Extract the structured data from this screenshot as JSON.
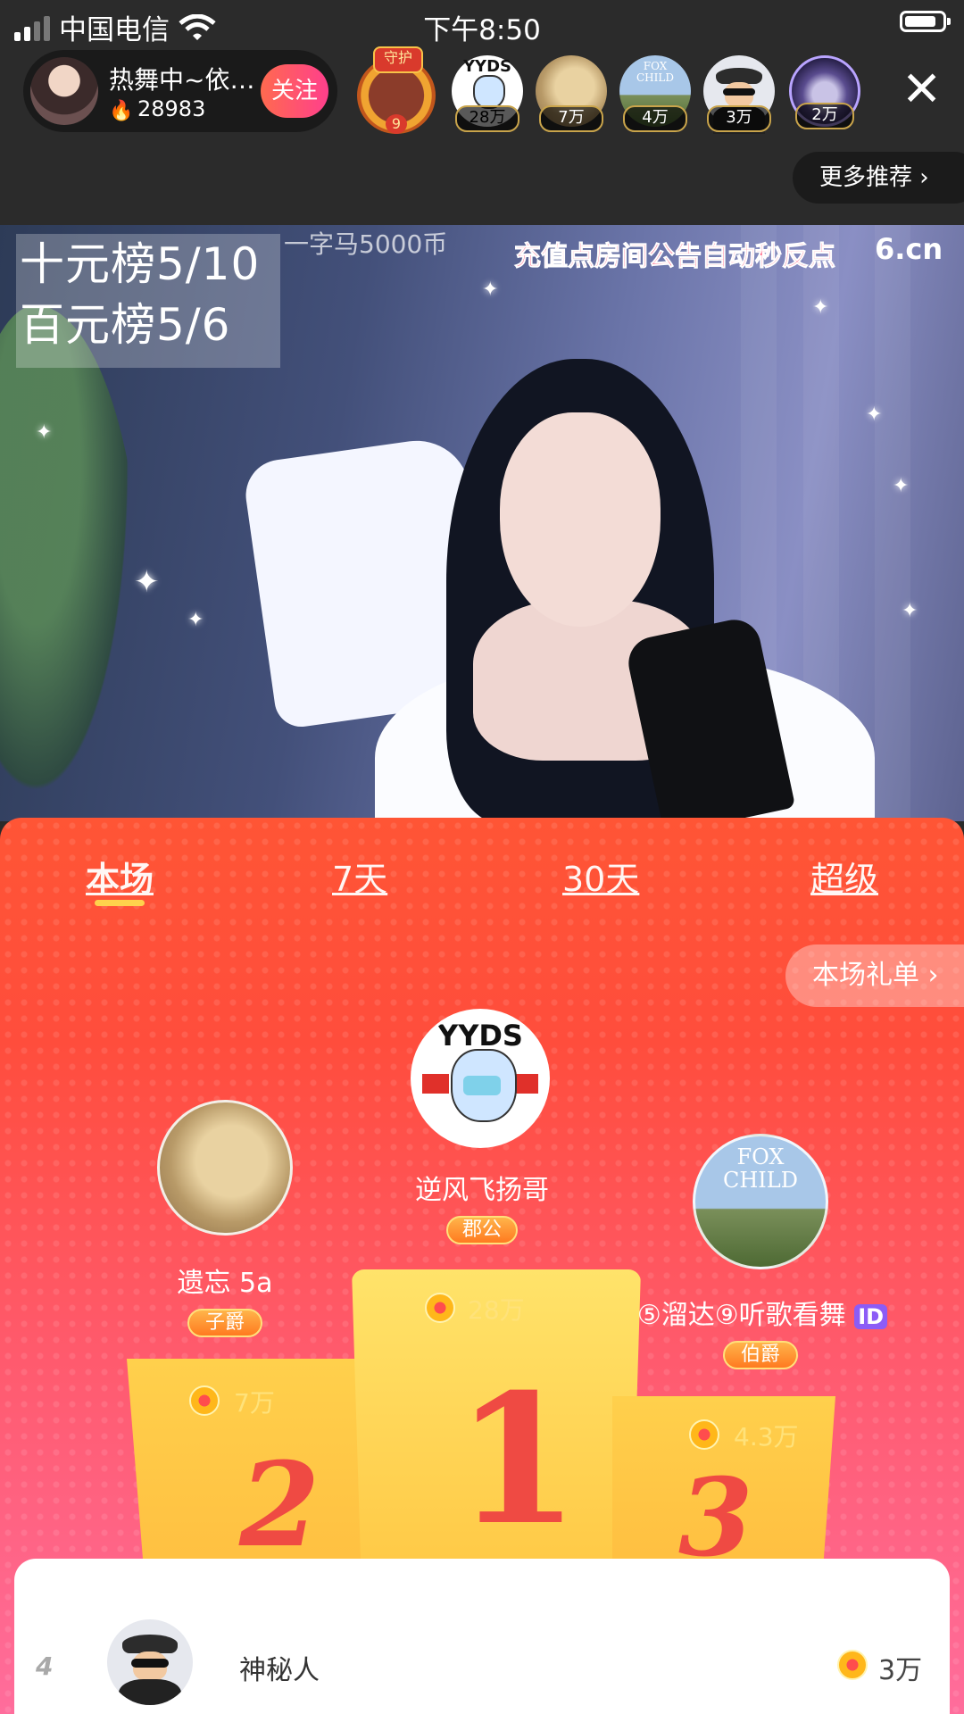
{
  "status_bar": {
    "carrier": "中国电信",
    "time": "下午8:50"
  },
  "host": {
    "name": "热舞中~依…",
    "heat": "28983",
    "follow_label": "关注"
  },
  "guard": {
    "tag": "守护",
    "level": "9"
  },
  "top_viewers": [
    {
      "amount": "28万",
      "avatar": "yyds-avatar"
    },
    {
      "amount": "7万",
      "avatar": "golden-face-avatar"
    },
    {
      "amount": "4万",
      "avatar": "fox-child-avatar"
    },
    {
      "amount": "3万",
      "avatar": "mystery-hat-avatar"
    },
    {
      "amount": "2万",
      "avatar": "planet-avatar"
    }
  ],
  "more_label": "更多推荐",
  "video": {
    "board_line1": "十元榜5/10",
    "board_line2": "百元榜5/6",
    "price_note": "一字马5000币",
    "notice": "充值点房间公告自动秒反点",
    "logo": "6.cn"
  },
  "ranking": {
    "tabs": [
      "本场",
      "7天",
      "30天",
      "超级"
    ],
    "active_tab": "本场",
    "gift_list_label": "本场礼单",
    "first": {
      "name": "逆风飞扬哥",
      "badge": "郡公",
      "amount": "28万",
      "rank": "1"
    },
    "second": {
      "name": "遗忘 5a",
      "badge": "子爵",
      "amount": "7万",
      "rank": "2"
    },
    "third": {
      "name": "⑤溜达⑨听歌看舞",
      "id_chip": "ID",
      "badge": "伯爵",
      "amount": "4.3万",
      "rank": "3"
    },
    "list": [
      {
        "rank": "4",
        "name": "神秘人",
        "amount": "3万"
      }
    ]
  },
  "colors": {
    "accent_pink": "#ff3f8c",
    "panel_top": "#ff5535",
    "panel_bottom": "#ff6d9c",
    "podium_gold": "#ffc33d"
  }
}
